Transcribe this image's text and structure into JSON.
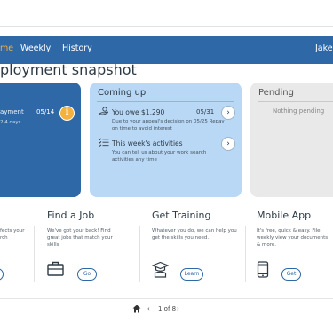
{
  "nav": {
    "items": [
      {
        "label": "me",
        "active": true
      },
      {
        "label": "Weekly",
        "active": false
      },
      {
        "label": "History",
        "active": false
      }
    ],
    "user": "Jake",
    "accent": "#f4b13d",
    "background": "#2f68a6"
  },
  "page_title": "ployment snapshot",
  "cards": {
    "left": {
      "item_label": "ayment",
      "item_date": "05/14",
      "item_sub": "2 4 days",
      "icon": "info-icon"
    },
    "coming_up": {
      "title": "Coming up",
      "items": [
        {
          "icon": "money-hand-icon",
          "title": "You owe $1,290",
          "date": "05/31",
          "desc": "Due to your appeal's decision on 05/25 Repay on time to avoid interest"
        },
        {
          "icon": "checklist-icon",
          "title": "This week's activities",
          "date": "",
          "desc": "You can tell us about your work search activities any time"
        }
      ]
    },
    "pending": {
      "title": "Pending",
      "empty_text": "Nothing pending"
    }
  },
  "features": [
    {
      "title": "",
      "desc": "fects your\nrch",
      "button": "",
      "icon": ""
    },
    {
      "title": "Find a Job",
      "desc": "We've got your back! Find great jobs that match your skills",
      "button": "Go",
      "icon": "briefcase-icon"
    },
    {
      "title": "Get Training",
      "desc": "Whatever you do, we can help you get the skills you need.",
      "button": "Learn",
      "icon": "graduation-icon"
    },
    {
      "title": "Mobile App",
      "desc": "It's free, quick & easy. File weekly view your documents & more.",
      "button": "Get",
      "icon": "phone-icon"
    }
  ],
  "pager": {
    "text": "1 of 8",
    "home_icon": "home-icon"
  }
}
